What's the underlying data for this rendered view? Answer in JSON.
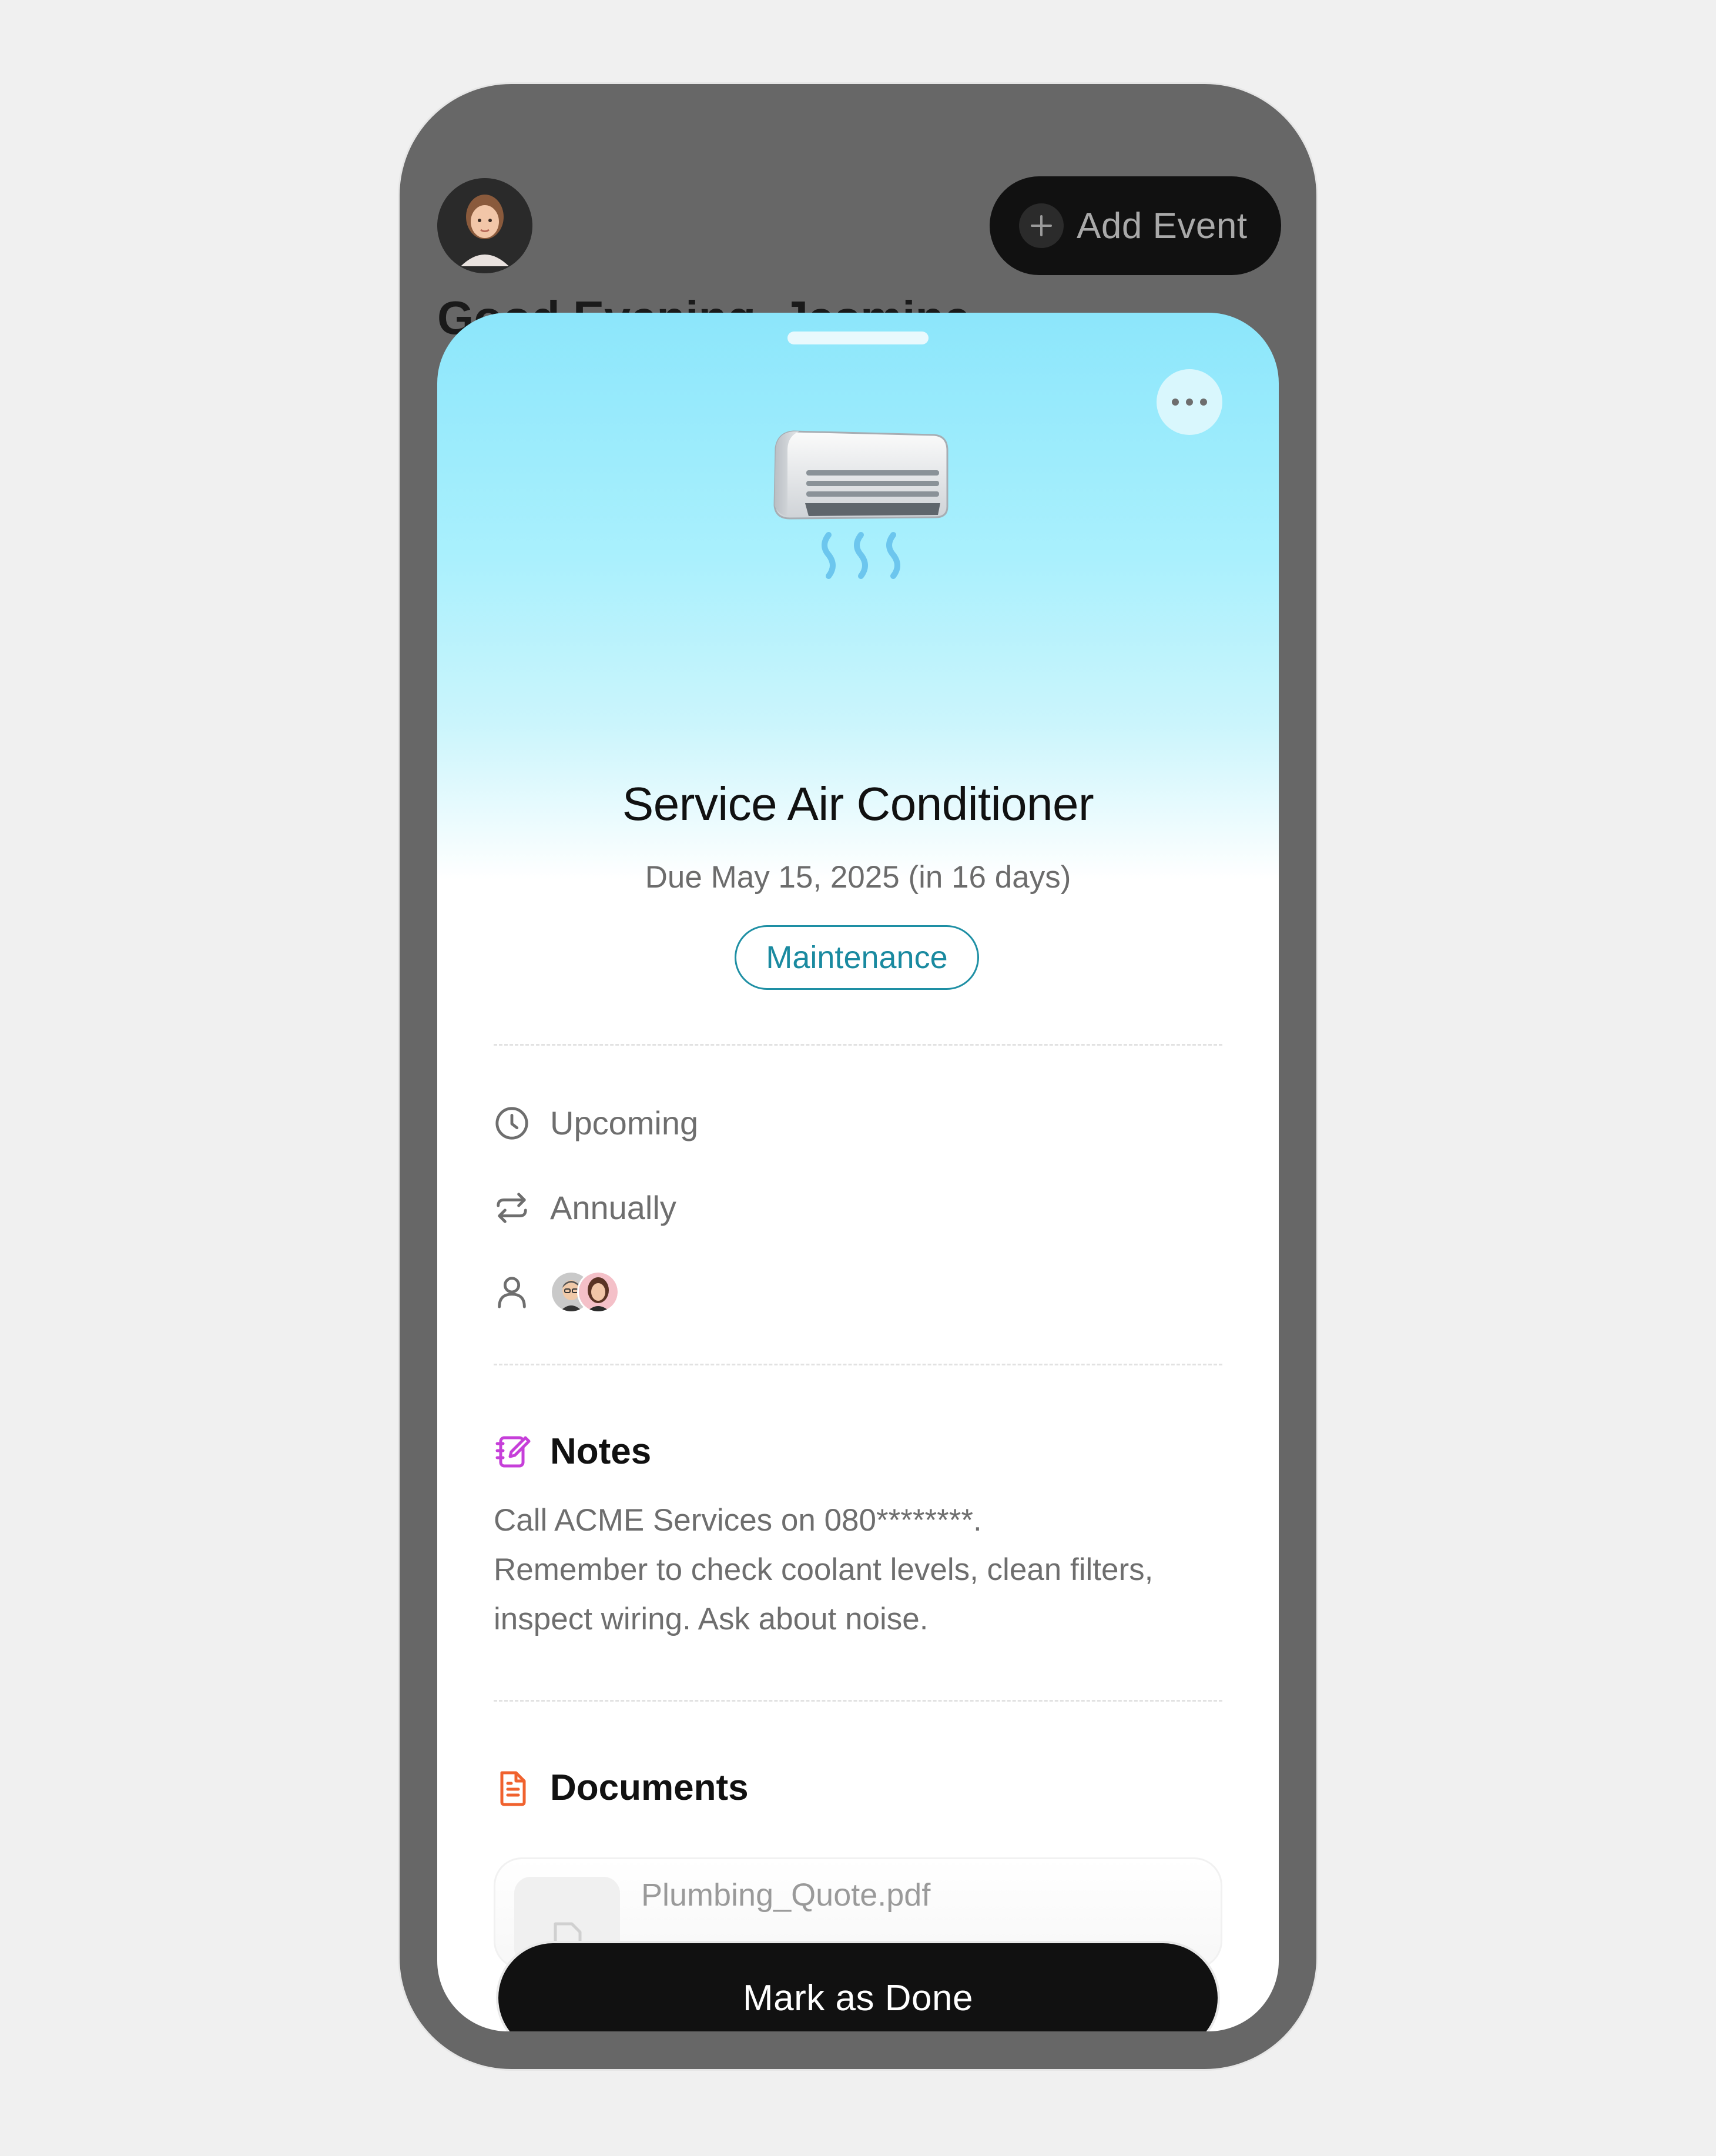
{
  "background": {
    "greeting": "Good Evening, Jasmine",
    "add_event_label": "Add Event"
  },
  "event": {
    "title": "Service Air Conditioner",
    "due": "Due May 15, 2025 (in 16 days)",
    "category": "Maintenance",
    "status": "Upcoming",
    "recurrence": "Annually",
    "icon": "air-conditioner-icon"
  },
  "notes": {
    "heading": "Notes",
    "lines": [
      "Call ACME Services on 080********.",
      "Remember to check coolant levels, clean filters,",
      "inspect wiring. Ask about noise."
    ]
  },
  "documents": {
    "heading": "Documents",
    "items": [
      {
        "name": "Plumbing_Quote.pdf"
      }
    ]
  },
  "actions": {
    "mark_done_label": "Mark as Done"
  },
  "colors": {
    "accent": "#1a8aa0",
    "sheet_top": "#8ce6fb",
    "notes_icon": "#c63fd9",
    "documents_icon": "#f0622e",
    "button": "#111111"
  }
}
